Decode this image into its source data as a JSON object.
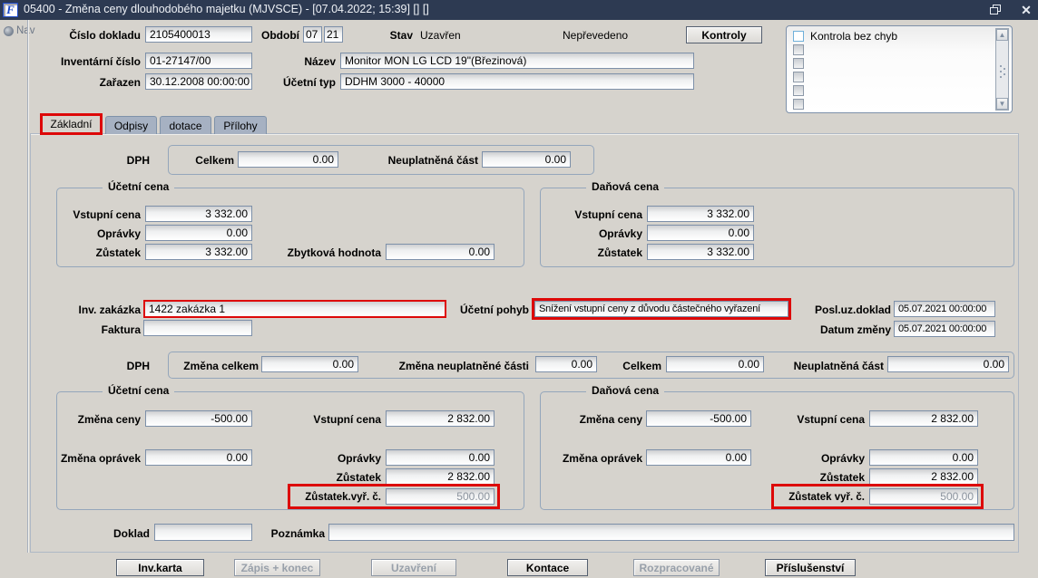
{
  "window": {
    "title": "05400 - Změna ceny dlouhodobého majetku (MJVSCE) - [07.04.2022; 15:39]  []  []",
    "app_icon_letter": "F",
    "close_glyph": "✕"
  },
  "nav": {
    "label": "Nav"
  },
  "header": {
    "doc_number": {
      "label": "Číslo dokladu",
      "value": "2105400013"
    },
    "period": {
      "label": "Období",
      "month": "07",
      "year": "21"
    },
    "state": {
      "label": "Stav",
      "value": "Uzavřen"
    },
    "transfer_status": "Nepřevedeno",
    "controls_button_label": "Kontroly",
    "inventory_number": {
      "label": "Inventární číslo",
      "value": "01-27147/00"
    },
    "asset_name": {
      "label": "Název",
      "value": "Monitor MON LG LCD 19\"(Březinová)"
    },
    "included_date": {
      "label": "Zařazen",
      "value": "30.12.2008 00:00:00"
    },
    "account_type": {
      "label": "Účetní typ",
      "value": "DDHM 3000 - 40000"
    },
    "check_list": {
      "items": [
        {
          "label": "Kontrola bez chyb",
          "checked": false
        },
        {
          "label": "",
          "checked": false
        },
        {
          "label": "",
          "checked": false
        },
        {
          "label": "",
          "checked": false
        },
        {
          "label": "",
          "checked": false
        },
        {
          "label": "",
          "checked": false
        }
      ],
      "scroll_up_glyph": "▲",
      "scroll_down_glyph": "▼"
    }
  },
  "tabs": [
    {
      "label": "Základní",
      "active": true,
      "highlighted": true
    },
    {
      "label": "Odpisy",
      "active": false
    },
    {
      "label": "dotace",
      "active": false
    },
    {
      "label": "Přílohy",
      "active": false
    }
  ],
  "vat_top": {
    "section_label": "DPH",
    "total": {
      "label": "Celkem",
      "value": "0.00"
    },
    "unapplied": {
      "label": "Neuplatněná část",
      "value": "0.00"
    }
  },
  "book_price": {
    "title": "Účetní cena",
    "entry_price": {
      "label": "Vstupní cena",
      "value": "3 332.00"
    },
    "depreciation": {
      "label": "Oprávky",
      "value": "0.00"
    },
    "remainder": {
      "label": "Zůstatek",
      "value": "3 332.00"
    },
    "residual": {
      "label": "Zbytková hodnota",
      "value": "0.00"
    }
  },
  "tax_price": {
    "title": "Daňová cena",
    "entry_price": {
      "label": "Vstupní cena",
      "value": "3 332.00"
    },
    "depreciation": {
      "label": "Oprávky",
      "value": "0.00"
    },
    "remainder": {
      "label": "Zůstatek",
      "value": "3 332.00"
    }
  },
  "movement": {
    "inv_order": {
      "label": "Inv. zakázka",
      "value": "1422 zakázka 1"
    },
    "invoice": {
      "label": "Faktura",
      "value": ""
    },
    "account_movement": {
      "label": "Účetní pohyb",
      "value": "Snížení vstupní ceny z důvodu částečného vyřazení"
    },
    "last_closed_doc": {
      "label": "Posl.uz.doklad",
      "value": "05.07.2021 00:00:00"
    },
    "change_date": {
      "label": "Datum změny",
      "value": "05.07.2021 00:00:00"
    }
  },
  "vat_change": {
    "section_label": "DPH",
    "change_total": {
      "label": "Změna celkem",
      "value": "0.00"
    },
    "change_unapplied": {
      "label": "Změna neuplatněné části",
      "value": "0.00"
    },
    "total": {
      "label": "Celkem",
      "value": "0.00"
    },
    "unapplied": {
      "label": "Neuplatněná část",
      "value": "0.00"
    }
  },
  "book_price_change": {
    "title": "Účetní cena",
    "price_change": {
      "label": "Změna ceny",
      "value": "-500.00"
    },
    "entry_price": {
      "label": "Vstupní cena",
      "value": "2 832.00"
    },
    "depreciation_change": {
      "label": "Změna oprávek",
      "value": "0.00"
    },
    "depreciation": {
      "label": "Oprávky",
      "value": "0.00"
    },
    "remainder": {
      "label": "Zůstatek",
      "value": "2 832.00"
    },
    "disposal_remainder": {
      "label": "Zůstatek.vyř. č.",
      "value": "500.00"
    }
  },
  "tax_price_change": {
    "title": "Daňová cena",
    "price_change": {
      "label": "Změna ceny",
      "value": "-500.00"
    },
    "entry_price": {
      "label": "Vstupní cena",
      "value": "2 832.00"
    },
    "depreciation_change": {
      "label": "Změna oprávek",
      "value": "0.00"
    },
    "depreciation": {
      "label": "Oprávky",
      "value": "0.00"
    },
    "remainder": {
      "label": "Zůstatek",
      "value": "2 832.00"
    },
    "disposal_remainder": {
      "label": "Zůstatek vyř. č.",
      "value": "500.00"
    }
  },
  "footer": {
    "document": {
      "label": "Doklad",
      "value": ""
    },
    "note": {
      "label": "Poznámka",
      "value": ""
    }
  },
  "buttons": [
    {
      "label": "Inv.karta",
      "enabled": true
    },
    {
      "label": "Zápis + konec",
      "enabled": false
    },
    {
      "label": "Uzavření",
      "enabled": false
    },
    {
      "label": "Kontace",
      "enabled": true
    },
    {
      "label": "Rozpracované",
      "enabled": false
    },
    {
      "label": "Příslušenství",
      "enabled": true
    }
  ],
  "colors": {
    "titlebar": "#2d3a52",
    "annotation_red": "#dd0808",
    "panel": "#d6d3cd",
    "tab_inactive": "#a6b1c2",
    "field_border": "#7d90a9",
    "disabled_text": "#8d959f"
  }
}
